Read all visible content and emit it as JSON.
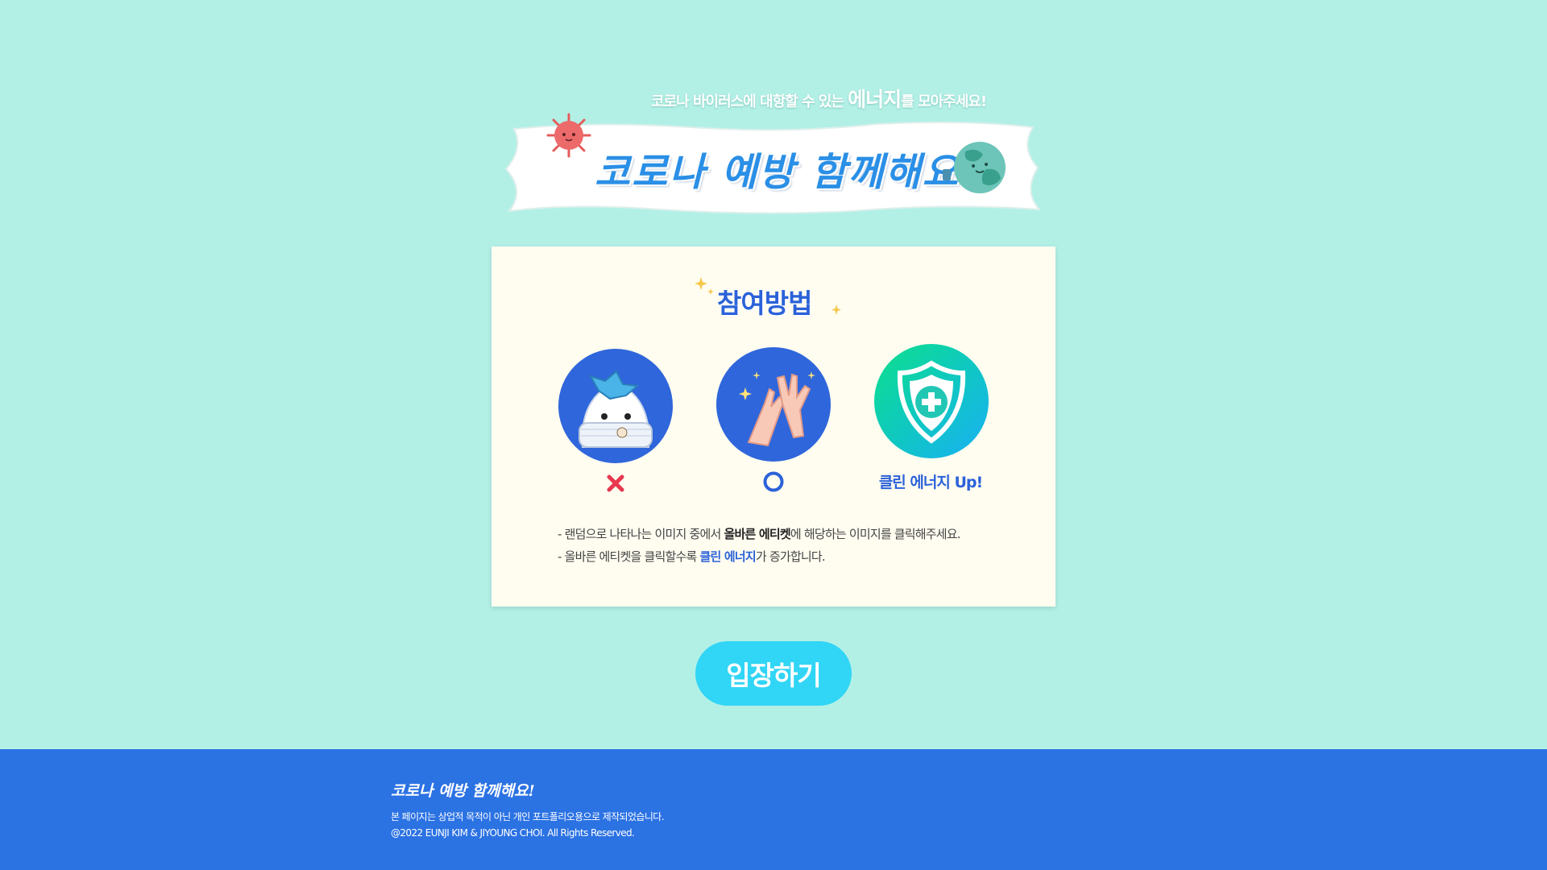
{
  "hero": {
    "tagline_prefix": "코로나 바이러스에 대항할 수 있는 ",
    "tagline_emphasis": "에너지",
    "tagline_suffix": "를 모아주세요!",
    "banner_title": "코로나 예방 함께해요!"
  },
  "how_to": {
    "title": "참여방법",
    "steps": [
      {
        "icon": "masked-character-icon",
        "verdict_icon": "wrong-x-icon"
      },
      {
        "icon": "washing-hands-icon",
        "verdict_icon": "correct-o-icon"
      },
      {
        "icon": "shield-cross-icon",
        "label": "클린 에너지 Up!"
      }
    ],
    "line1_prefix": "- 랜덤으로 나타나는 이미지 중에서 ",
    "line1_bold": "올바른 에티켓",
    "line1_suffix": "에 해당하는 이미지를 클릭해주세요.",
    "line2_prefix": "- 올바른 에티켓을 클릭할수록 ",
    "line2_highlight": "클린 에너지",
    "line2_suffix": "가 증가합니다."
  },
  "cta": {
    "enter_label": "입장하기"
  },
  "footer": {
    "logo": "코로나 예방 함께해요!",
    "notice": "본 페이지는 상업적 목적이 아닌 개인 포트폴리오용으로 제작되었습니다.",
    "copyright": "@2022 EUNJI KIM & JIYOUNG CHOI. All Rights Reserved."
  },
  "colors": {
    "background": "#b2f0e6",
    "accent_blue": "#2b62d9",
    "button": "#31d5f5",
    "footer": "#2b72e3",
    "wrong": "#e8384f"
  }
}
